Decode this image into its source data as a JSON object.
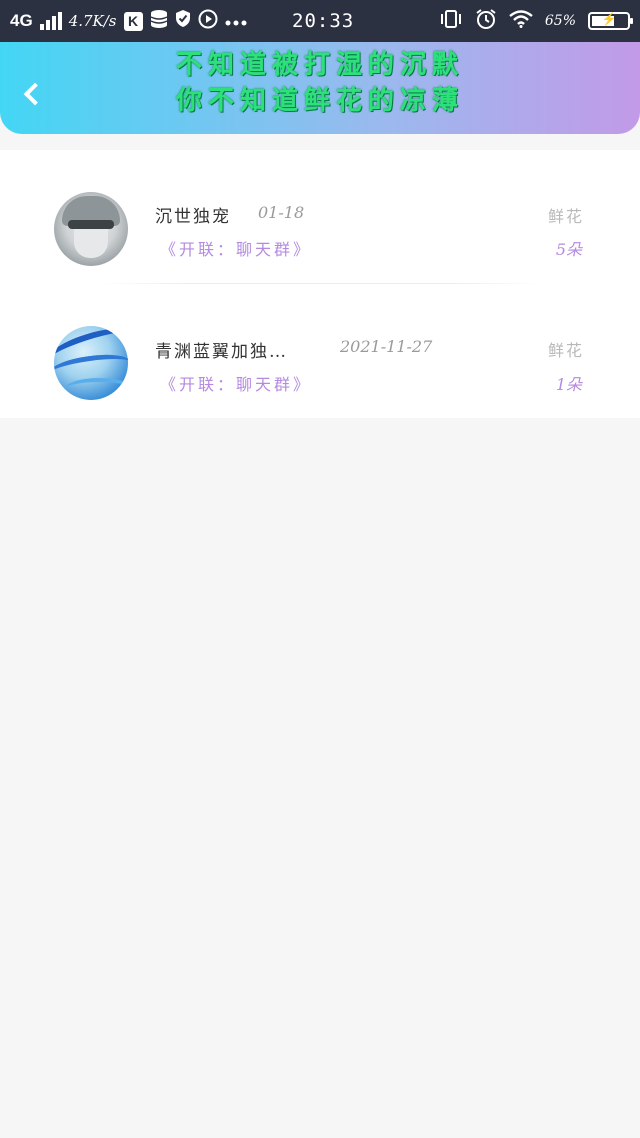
{
  "status_bar": {
    "network": "4G",
    "speed": "4.7K/s",
    "k_icon": "K",
    "time": "20:33",
    "battery_pct": "65%",
    "battery_level": 0.65,
    "icons": [
      "signal-icon",
      "k-app-icon",
      "database-icon",
      "shield-icon",
      "play-icon",
      "more-icon",
      "vibrate-icon",
      "alarm-icon",
      "wifi-icon",
      "battery-icon"
    ]
  },
  "header": {
    "line1": "不知道被打湿的沉默",
    "line2": "你不知道鲜花的凉薄",
    "colors": {
      "gradient_start": "#43d6f4",
      "gradient_end": "#c29ae8",
      "title": "#2ee07a"
    }
  },
  "records": [
    {
      "name": "沉世独宠",
      "date": "01-18",
      "group": "《开联：聊天群》",
      "flower_label": "鲜花",
      "flower_count": "5朵"
    },
    {
      "name": "青渊蓝翼加独…",
      "date": "2021-11-27",
      "group": "《开联：聊天群》",
      "flower_label": "鲜花",
      "flower_count": "1朵"
    }
  ]
}
